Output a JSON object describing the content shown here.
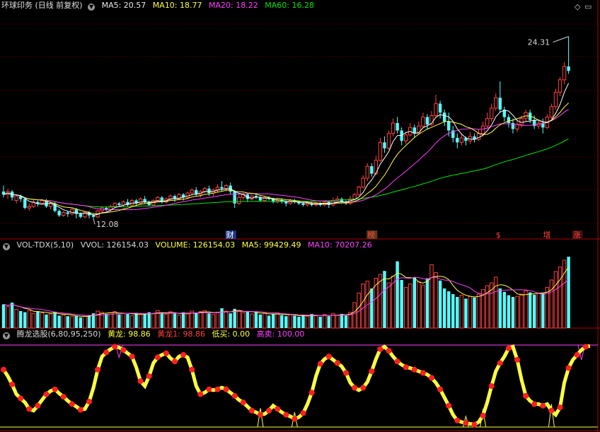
{
  "colors": {
    "up": "#ff4040",
    "down": "#54ffff",
    "ma5": "#ffffff",
    "ma10": "#ffff40",
    "ma20": "#ff40ff",
    "ma60": "#00e600",
    "grid": "#7a0000",
    "sep": "#b00000",
    "white_text": "#d8d8d8"
  },
  "price_panel": {
    "title": "环球印务 (日线 前复权)",
    "ma5": "MA5: 20.57",
    "ma10": "MA10: 18.77",
    "ma20": "MA20: 18.22",
    "ma60": "MA60: 16.28",
    "high_label": "24.31",
    "low_label": "12.08",
    "event_markers": [
      {
        "text": "财",
        "color": "#ffffff",
        "bg": "#1f3a8a",
        "day": 53
      },
      {
        "text": "榜",
        "color": "#ff4040",
        "bg": "#5a3a1a",
        "day": 86
      },
      {
        "text": "$",
        "color": "#ff4040",
        "bg": "",
        "day": 116
      },
      {
        "text": "增",
        "color": "#ff4040",
        "bg": "",
        "day": 127
      },
      {
        "text": "涨",
        "color": "#ff4040",
        "bg": "#3a1010",
        "day": 134
      }
    ]
  },
  "volume_panel": {
    "title": "VOL-TDX(5,10)",
    "vvol": "VVOL: 126154.03",
    "volume": "VOLUME: 126154.03",
    "ma5": "MA5: 99429.49",
    "ma10": "MA10: 70207.26"
  },
  "indicator_panel": {
    "title": "腾龙选股(6,80,95,250)",
    "huanglong": "黄龙: 98.86",
    "huanglong1": "黄龙1: 98.86",
    "dimai": "低买: 0.00",
    "gaomai": "高卖: 100.00"
  },
  "chart_data": {
    "type": "candlestick",
    "price_range": [
      11.0,
      26.0
    ],
    "candles": [
      [
        13.9,
        13.7,
        14.3,
        13.5
      ],
      [
        13.7,
        13.9,
        14.1,
        13.4
      ],
      [
        13.9,
        13.5,
        14.0,
        13.3
      ],
      [
        13.3,
        13.6,
        13.7,
        13.1
      ],
      [
        13.6,
        13.4,
        13.7,
        13.2
      ],
      [
        13.4,
        12.8,
        13.5,
        12.7
      ],
      [
        12.8,
        12.9,
        13.1,
        12.6
      ],
      [
        12.9,
        13.2,
        13.4,
        12.8
      ],
      [
        13.2,
        13.1,
        13.3,
        12.9
      ],
      [
        13.1,
        13.3,
        13.4,
        13.0
      ],
      [
        13.3,
        12.9,
        13.4,
        12.8
      ],
      [
        12.9,
        13.1,
        13.2,
        12.7
      ],
      [
        13.1,
        12.6,
        13.2,
        12.5
      ],
      [
        12.6,
        12.3,
        12.7,
        12.2
      ],
      [
        12.3,
        12.5,
        12.6,
        12.2
      ],
      [
        12.5,
        12.4,
        12.6,
        12.2
      ],
      [
        12.4,
        12.7,
        12.8,
        12.3
      ],
      [
        12.7,
        12.4,
        12.8,
        12.1
      ],
      [
        12.4,
        12.2,
        12.5,
        12.1
      ],
      [
        12.2,
        12.5,
        12.6,
        12.1
      ],
      [
        12.5,
        12.3,
        12.6,
        12.1
      ],
      [
        12.3,
        12.2,
        12.4,
        12.08
      ],
      [
        12.2,
        12.6,
        12.7,
        12.1
      ],
      [
        12.6,
        12.8,
        12.9,
        12.5
      ],
      [
        12.8,
        12.7,
        12.9,
        12.6
      ],
      [
        12.7,
        12.9,
        13.0,
        12.6
      ],
      [
        12.9,
        13.1,
        13.2,
        12.8
      ],
      [
        13.1,
        13.0,
        13.2,
        12.9
      ],
      [
        13.0,
        13.2,
        13.3,
        12.9
      ],
      [
        13.2,
        13.0,
        13.4,
        12.9
      ],
      [
        13.0,
        13.3,
        13.4,
        12.9
      ],
      [
        13.3,
        13.1,
        13.4,
        13.0
      ],
      [
        13.1,
        13.4,
        13.5,
        13.0
      ],
      [
        13.4,
        13.2,
        13.6,
        13.1
      ],
      [
        13.2,
        13.0,
        13.3,
        12.9
      ],
      [
        13.0,
        13.3,
        13.4,
        12.9
      ],
      [
        13.3,
        13.5,
        13.6,
        13.2
      ],
      [
        13.5,
        13.2,
        13.6,
        13.1
      ],
      [
        13.2,
        13.4,
        13.5,
        13.1
      ],
      [
        13.4,
        13.6,
        13.7,
        13.3
      ],
      [
        13.6,
        13.4,
        13.7,
        13.2
      ],
      [
        13.4,
        13.7,
        13.8,
        13.3
      ],
      [
        13.7,
        13.5,
        13.8,
        13.3
      ],
      [
        13.5,
        13.8,
        13.9,
        13.4
      ],
      [
        13.8,
        14.0,
        14.1,
        13.7
      ],
      [
        14.0,
        13.7,
        14.2,
        13.6
      ],
      [
        13.7,
        13.9,
        14.0,
        13.5
      ],
      [
        13.9,
        14.1,
        14.2,
        13.8
      ],
      [
        14.1,
        13.8,
        14.3,
        13.6
      ],
      [
        13.8,
        14.0,
        14.1,
        13.6
      ],
      [
        14.0,
        14.2,
        14.4,
        13.8
      ],
      [
        14.2,
        14.1,
        14.6,
        13.9
      ],
      [
        14.1,
        14.3,
        14.4,
        13.9
      ],
      [
        14.3,
        13.9,
        14.5,
        13.7
      ],
      [
        13.9,
        13.1,
        14.0,
        12.8
      ],
      [
        13.1,
        13.5,
        13.7,
        13.0
      ],
      [
        13.5,
        13.7,
        13.8,
        13.3
      ],
      [
        13.7,
        13.4,
        13.8,
        13.2
      ],
      [
        13.4,
        13.6,
        13.7,
        13.3
      ],
      [
        13.6,
        13.5,
        13.8,
        13.4
      ],
      [
        13.5,
        13.3,
        13.6,
        13.2
      ],
      [
        13.3,
        13.5,
        13.6,
        13.2
      ],
      [
        13.5,
        13.4,
        13.6,
        13.3
      ],
      [
        13.4,
        13.2,
        13.5,
        13.1
      ],
      [
        13.2,
        13.3,
        13.4,
        13.1
      ],
      [
        13.3,
        13.2,
        13.4,
        13.1
      ],
      [
        13.2,
        13.1,
        13.3,
        12.9
      ],
      [
        13.1,
        13.3,
        13.4,
        13.0
      ],
      [
        13.3,
        13.2,
        13.4,
        13.1
      ],
      [
        13.2,
        13.1,
        13.3,
        13.0
      ],
      [
        13.1,
        13.0,
        13.2,
        12.9
      ],
      [
        13.0,
        13.1,
        13.2,
        12.9
      ],
      [
        13.1,
        13.0,
        13.2,
        12.9
      ],
      [
        13.0,
        13.1,
        13.2,
        12.9
      ],
      [
        13.1,
        13.0,
        13.2,
        12.9
      ],
      [
        13.0,
        13.2,
        13.3,
        12.9
      ],
      [
        13.2,
        13.0,
        13.3,
        12.8
      ],
      [
        13.0,
        13.3,
        13.5,
        12.9
      ],
      [
        13.3,
        13.4,
        13.6,
        13.2
      ],
      [
        13.4,
        13.2,
        13.5,
        13.1
      ],
      [
        13.2,
        13.1,
        13.3,
        13.0
      ],
      [
        13.1,
        13.4,
        13.6,
        13.0
      ],
      [
        13.4,
        13.7,
        13.8,
        13.3
      ],
      [
        13.7,
        14.2,
        14.3,
        13.6
      ],
      [
        14.2,
        14.8,
        15.0,
        14.1
      ],
      [
        14.8,
        15.6,
        15.8,
        14.6
      ],
      [
        15.6,
        15.1,
        15.8,
        14.9
      ],
      [
        15.1,
        16.0,
        16.3,
        15.0
      ],
      [
        16.0,
        17.2,
        17.5,
        15.9
      ],
      [
        17.2,
        16.8,
        17.6,
        16.5
      ],
      [
        16.8,
        17.8,
        18.0,
        16.7
      ],
      [
        17.8,
        18.5,
        18.8,
        17.6
      ],
      [
        18.5,
        18.0,
        18.9,
        17.8
      ],
      [
        18.0,
        17.3,
        18.2,
        17.0
      ],
      [
        17.3,
        17.7,
        17.9,
        17.1
      ],
      [
        17.7,
        18.2,
        18.5,
        17.6
      ],
      [
        18.2,
        17.8,
        18.4,
        17.5
      ],
      [
        17.8,
        18.3,
        18.6,
        17.7
      ],
      [
        18.3,
        18.9,
        19.2,
        18.2
      ],
      [
        18.9,
        18.4,
        19.1,
        18.1
      ],
      [
        18.4,
        19.0,
        19.3,
        18.3
      ],
      [
        19.0,
        19.8,
        20.4,
        18.9
      ],
      [
        19.8,
        19.2,
        20.0,
        18.8
      ],
      [
        19.2,
        18.6,
        19.4,
        18.3
      ],
      [
        18.6,
        18.0,
        19.2,
        17.6
      ],
      [
        18.0,
        17.5,
        18.3,
        17.2
      ],
      [
        17.5,
        17.2,
        17.8,
        16.8
      ],
      [
        17.2,
        17.5,
        17.8,
        17.0
      ],
      [
        17.5,
        17.3,
        17.6,
        17.0
      ],
      [
        17.3,
        17.6,
        17.9,
        17.1
      ],
      [
        17.6,
        17.4,
        17.8,
        17.2
      ],
      [
        17.4,
        17.8,
        18.1,
        17.3
      ],
      [
        17.8,
        18.3,
        18.6,
        17.6
      ],
      [
        18.3,
        18.8,
        19.2,
        18.1
      ],
      [
        18.8,
        19.5,
        19.8,
        18.6
      ],
      [
        19.5,
        20.2,
        20.5,
        19.3
      ],
      [
        20.2,
        19.4,
        21.3,
        19.2
      ],
      [
        19.4,
        18.9,
        19.6,
        18.6
      ],
      [
        18.9,
        18.5,
        19.1,
        18.2
      ],
      [
        18.5,
        18.1,
        18.8,
        17.8
      ],
      [
        18.1,
        18.4,
        18.7,
        17.9
      ],
      [
        18.4,
        18.8,
        19.0,
        18.2
      ],
      [
        18.8,
        19.2,
        19.4,
        18.6
      ],
      [
        19.2,
        18.7,
        19.4,
        18.5
      ],
      [
        18.7,
        18.3,
        19.0,
        18.1
      ],
      [
        18.3,
        18.5,
        18.7,
        18.1
      ],
      [
        18.5,
        18.2,
        18.8,
        17.8
      ],
      [
        18.2,
        18.9,
        19.1,
        18.1
      ],
      [
        18.9,
        19.6,
        19.8,
        18.8
      ],
      [
        19.6,
        20.57,
        20.8,
        19.4
      ],
      [
        20.57,
        21.4,
        21.6,
        20.3
      ],
      [
        21.4,
        22.3,
        22.6,
        21.1
      ],
      [
        22.3,
        22.0,
        24.31,
        21.8
      ]
    ],
    "volume_range": [
      0,
      140000
    ],
    "volume": [
      42000,
      38000,
      45000,
      33000,
      30000,
      28000,
      31000,
      26000,
      30000,
      27000,
      24000,
      25000,
      29000,
      22000,
      23000,
      21000,
      20000,
      22000,
      19000,
      21000,
      23000,
      26000,
      30000,
      28000,
      25000,
      27000,
      29000,
      24000,
      26000,
      25000,
      22000,
      27000,
      24000,
      26000,
      28000,
      25000,
      31000,
      27000,
      24000,
      29000,
      26000,
      23000,
      28000,
      25000,
      30000,
      27000,
      29000,
      31000,
      26000,
      24000,
      28000,
      35000,
      30000,
      26000,
      34000,
      31000,
      27000,
      29000,
      25000,
      28000,
      24000,
      26000,
      22000,
      25000,
      27000,
      23000,
      21000,
      24000,
      22000,
      20000,
      23000,
      21000,
      25000,
      22000,
      20000,
      24000,
      21000,
      26000,
      23000,
      25000,
      22000,
      28000,
      45000,
      62000,
      78000,
      83000,
      70000,
      88000,
      95000,
      101000,
      80000,
      92000,
      118000,
      85000,
      72000,
      78000,
      90000,
      82000,
      76000,
      88000,
      112000,
      98000,
      84000,
      70000,
      65000,
      60000,
      55000,
      58000,
      52000,
      56000,
      54000,
      60000,
      68000,
      75000,
      80000,
      90000,
      70000,
      64000,
      58000,
      55000,
      56000,
      60000,
      66000,
      63000,
      59000,
      61000,
      62000,
      72000,
      85000,
      100000,
      108000,
      120000,
      126154
    ],
    "indicator_range": [
      0,
      100
    ],
    "huanglong": [
      70,
      62,
      52,
      40,
      35,
      30,
      22,
      20,
      26,
      33,
      40,
      44,
      46,
      41,
      37,
      32,
      28,
      25,
      21,
      22,
      31,
      48,
      70,
      86,
      91,
      95,
      98,
      97,
      94,
      90,
      86,
      73,
      56,
      50,
      62,
      78,
      85,
      88,
      90,
      84,
      80,
      86,
      88,
      85,
      70,
      50,
      40,
      42,
      46,
      45,
      46,
      48,
      46,
      42,
      38,
      33,
      30,
      25,
      20,
      18,
      15,
      16,
      20,
      26,
      22,
      18,
      15,
      13,
      10,
      12,
      17,
      28,
      42,
      62,
      77,
      83,
      86,
      82,
      78,
      74,
      66,
      54,
      48,
      45,
      48,
      55,
      68,
      83,
      95,
      98,
      93,
      86,
      80,
      76,
      73,
      72,
      70,
      68,
      66,
      64,
      60,
      54,
      46,
      36,
      26,
      15,
      8,
      6,
      5,
      4,
      3,
      6,
      14,
      30,
      50,
      68,
      78,
      86,
      96,
      98,
      82,
      58,
      38,
      32,
      28,
      28,
      26,
      28,
      20,
      15,
      24,
      54,
      72,
      82,
      88,
      94,
      98,
      98.86
    ],
    "gaomai_level": 100,
    "dimai_level": 0
  }
}
